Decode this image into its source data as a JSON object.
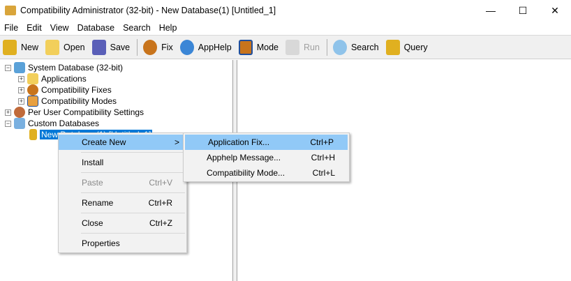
{
  "window": {
    "title": "Compatibility Administrator (32-bit) - New Database(1) [Untitled_1]",
    "minimize": "—",
    "maximize": "☐",
    "close": "✕"
  },
  "menubar": [
    "File",
    "Edit",
    "View",
    "Database",
    "Search",
    "Help"
  ],
  "toolbar": [
    {
      "label": "New",
      "icon": "database-icon",
      "color": "#e0b020",
      "enabled": true
    },
    {
      "label": "Open",
      "icon": "folder-open-icon",
      "color": "#f2cf5b",
      "enabled": true
    },
    {
      "label": "Save",
      "icon": "floppy-disk-icon",
      "color": "#5a5fb8",
      "enabled": true
    },
    {
      "label": "Fix",
      "icon": "gear-icon",
      "color": "#c8741c",
      "enabled": true
    },
    {
      "label": "AppHelp",
      "icon": "info-icon",
      "color": "#3b86d6",
      "enabled": true
    },
    {
      "label": "Mode",
      "icon": "mode-window-icon",
      "color": "#c8741c",
      "enabled": true
    },
    {
      "label": "Run",
      "icon": "run-icon",
      "color": "#c0c0c0",
      "enabled": false
    },
    {
      "label": "Search",
      "icon": "magnifier-icon",
      "color": "#8fc3ea",
      "enabled": true
    },
    {
      "label": "Query",
      "icon": "query-database-icon",
      "color": "#e0b020",
      "enabled": true
    }
  ],
  "tree": {
    "system": "System Database (32-bit)",
    "applications": "Applications",
    "fixes": "Compatibility Fixes",
    "modes": "Compatibility Modes",
    "per_user": "Per User Compatibility Settings",
    "custom": "Custom Databases",
    "new_db": "New Database(1) [Untitled_1]"
  },
  "context_menu": {
    "create_new": "Create New",
    "create_arrow": ">",
    "install": "Install",
    "paste": "Paste",
    "paste_sc": "Ctrl+V",
    "rename": "Rename",
    "rename_sc": "Ctrl+R",
    "close": "Close",
    "close_sc": "Ctrl+Z",
    "properties": "Properties"
  },
  "submenu": {
    "app_fix": "Application Fix...",
    "app_fix_sc": "Ctrl+P",
    "apphelp": "Apphelp Message...",
    "apphelp_sc": "Ctrl+H",
    "compat_mode": "Compatibility Mode...",
    "compat_mode_sc": "Ctrl+L"
  }
}
